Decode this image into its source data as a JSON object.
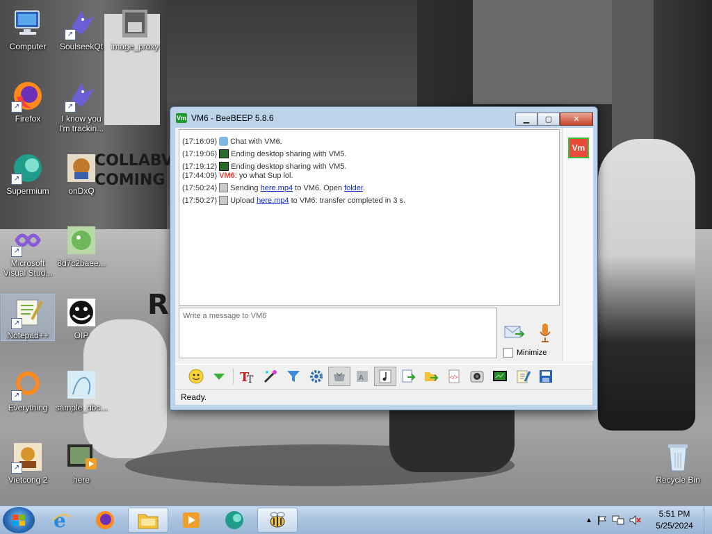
{
  "desktop": {
    "wallpaper_text": [
      "COLLABV",
      "COMING",
      "R"
    ],
    "icons": [
      {
        "label": "Computer"
      },
      {
        "label": "SoulseekQt"
      },
      {
        "label": "image_proxy"
      },
      {
        "label": "Firefox"
      },
      {
        "label": "I know you I'm trackin..."
      },
      {
        "label": "Supermium"
      },
      {
        "label": "onDxQ"
      },
      {
        "label": "Microsoft Visual Stud..."
      },
      {
        "label": "8d7c2baee..."
      },
      {
        "label": "Notepad++"
      },
      {
        "label": "OIP"
      },
      {
        "label": "Everything"
      },
      {
        "label": "sample_dbc..."
      },
      {
        "label": "Vietcong 2"
      },
      {
        "label": "here"
      },
      {
        "label": "Recycle Bin"
      }
    ]
  },
  "window": {
    "title": "VM6 - BeeBEEP 5.8.6",
    "app_icon_text": "Vm",
    "controls": {
      "minimize": "▁",
      "maximize": "▢",
      "close": "✕"
    },
    "messages": [
      {
        "time": "(17:16:09)",
        "text": "Chat with VM6."
      },
      {
        "time": "(17:19:06)",
        "text": "Ending desktop sharing with VM5."
      },
      {
        "time": "(17:19:12)",
        "text": "Ending desktop sharing with VM5."
      },
      {
        "time": "(17:44:09)",
        "sender": "VM6",
        "text": ": yo what Sup lol."
      },
      {
        "time": "(17:50:24)",
        "pre": "Sending ",
        "link": "here.mp4",
        "mid": " to VM6. Open ",
        "link2": "folder",
        "post": "."
      },
      {
        "time": "(17:50:27)",
        "pre": "Upload ",
        "link": "here.mp4",
        "post": " to VM6: transfer completed in 3 s."
      }
    ],
    "avatar_text": "Vm",
    "input_placeholder": "Write a message to VM6",
    "minimize_label": "Minimize",
    "status": "Ready."
  },
  "taskbar": {
    "clock_time": "5:51 PM",
    "clock_date": "5/25/2024"
  },
  "colors": {
    "accent_green": "#35c33c",
    "avatar_red": "#e84a3a",
    "link_blue": "#0b25c8",
    "titlebar": "#bcd3ea"
  }
}
